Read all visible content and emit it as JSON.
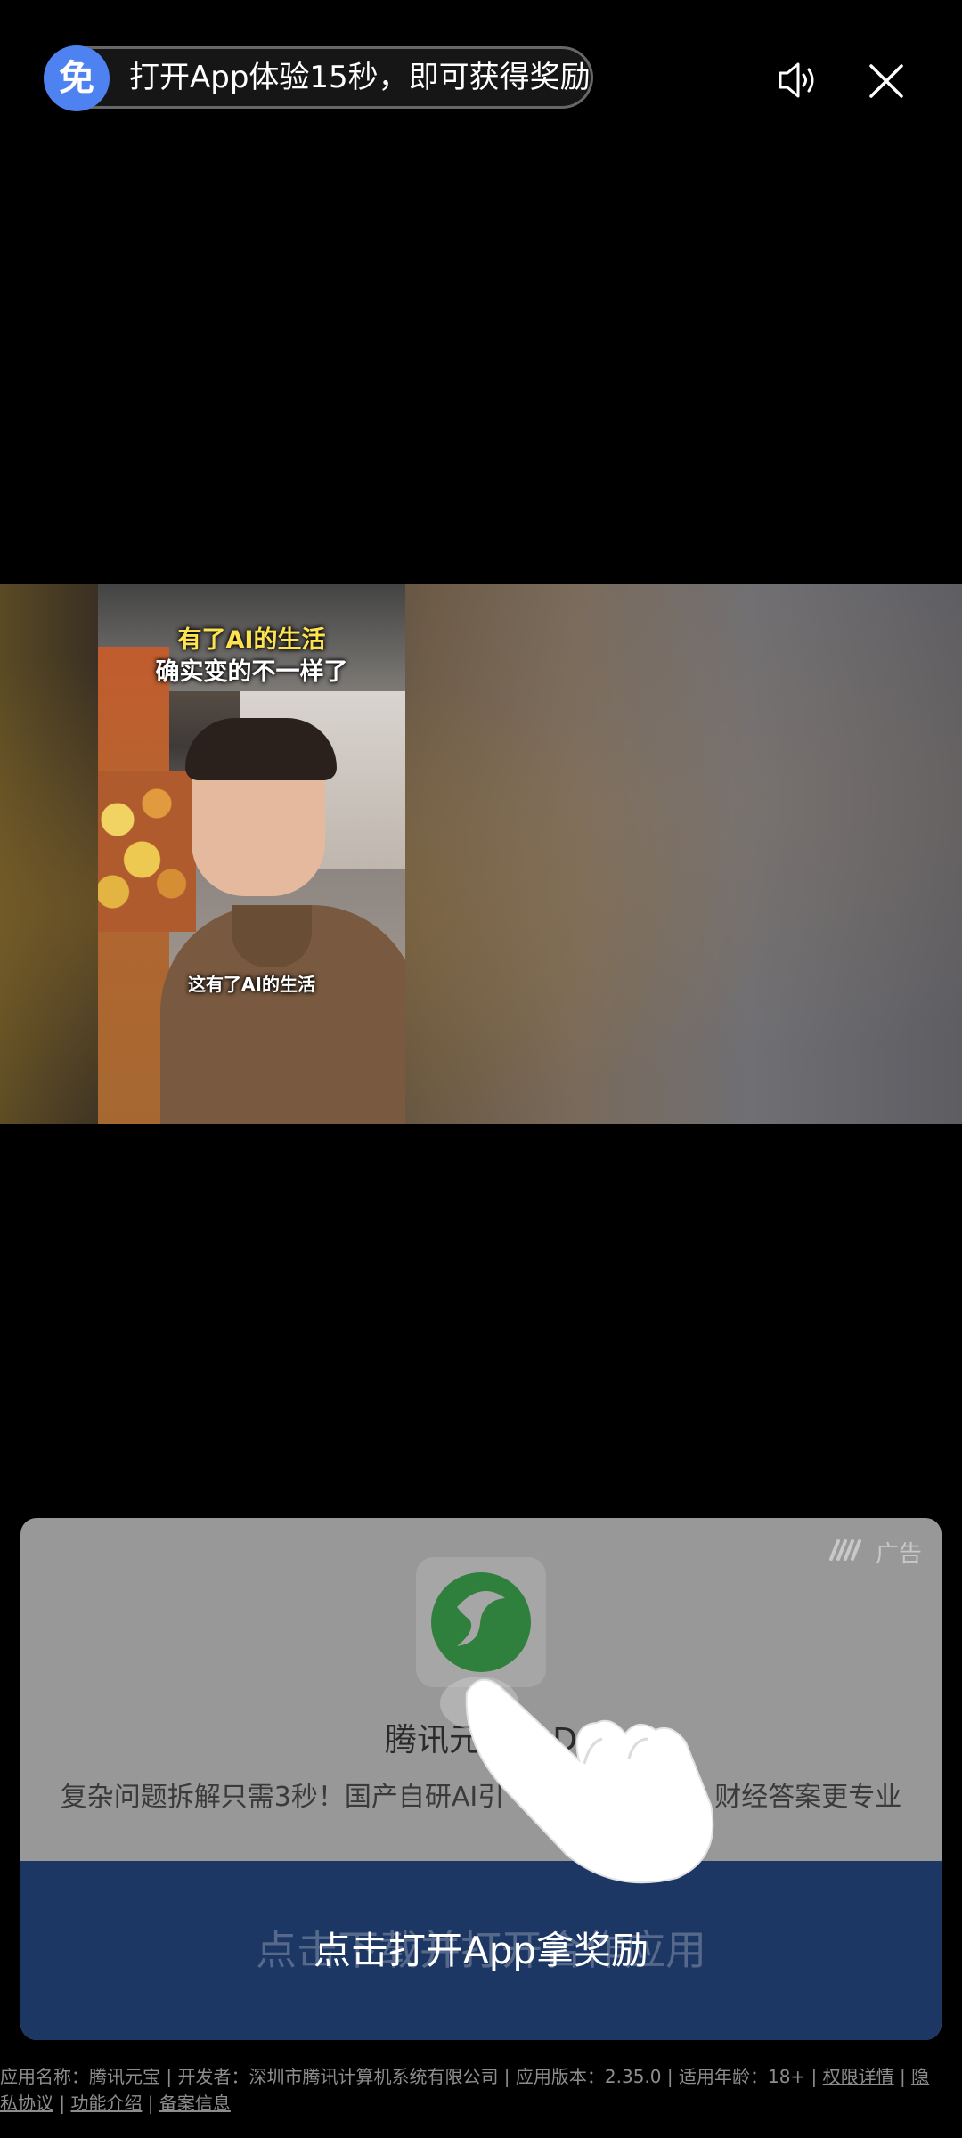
{
  "top_bar": {
    "badge": "免",
    "reward_text": "打开App体验15秒，即可获得奖励"
  },
  "video": {
    "caption_line1": "有了AI的生活",
    "caption_line2": "确实变的不一样了",
    "caption_sub": "这有了AI的生活"
  },
  "ad": {
    "label": "广告",
    "app_name": "腾讯元宝 x D",
    "description": "复杂问题拆解只需3秒！国产自研AI引",
    "description_tail": "财经答案更专业",
    "cta_ghost": "点击下载并打开合作应用",
    "cta": "点击打开App拿奖励"
  },
  "footer": {
    "app_name": "应用名称：腾讯元宝",
    "developer": "开发者：深圳市腾讯计算机系统有限公司",
    "version": "应用版本：2.35.0",
    "age": "适用年龄：18+",
    "permissions": "权限详情",
    "privacy_a": "隐",
    "privacy_b": "私协议",
    "features": "功能介绍",
    "filing": "备案信息",
    "sep": " | "
  },
  "colors": {
    "badge_blue": "#4e82f0",
    "cta_bg": "#1c3763",
    "card_bg": "#989898",
    "app_icon_green": "#2f7f3d"
  },
  "icons": [
    "speaker-icon",
    "close-icon",
    "ad-brand-icon",
    "app-logo-icon",
    "tap-hand-icon"
  ]
}
